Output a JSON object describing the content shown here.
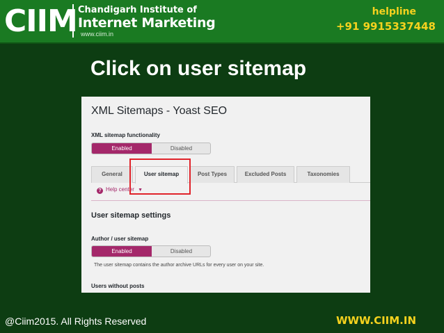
{
  "header": {
    "logo_text": "CIIM",
    "institute_line1": "Chandigarh Institute of",
    "institute_line2": "Internet Marketing",
    "url": "www.ciim.in",
    "helpline_label": "helpline",
    "helpline_number": "+91 9915337448"
  },
  "slide": {
    "title": "Click on user sitemap"
  },
  "screenshot": {
    "page_title": "XML Sitemaps - Yoast SEO",
    "functionality_label": "XML sitemap functionality",
    "functionality_toggle": {
      "on_label": "Enabled",
      "off_label": "Disabled",
      "selected": "Enabled"
    },
    "tabs": [
      {
        "label": "General",
        "active": false
      },
      {
        "label": "User sitemap",
        "active": true
      },
      {
        "label": "Post Types",
        "active": false
      },
      {
        "label": "Excluded Posts",
        "active": false
      },
      {
        "label": "Taxonomies",
        "active": false
      }
    ],
    "help_center_label": "Help center",
    "help_icon_glyph": "?",
    "section_title": "User sitemap settings",
    "author_label": "Author / user sitemap",
    "author_toggle": {
      "on_label": "Enabled",
      "off_label": "Disabled",
      "selected": "Enabled"
    },
    "author_description": "The user sitemap contains the author archive URLs for every user on your site.",
    "users_without_posts_label": "Users without posts"
  },
  "colors": {
    "background": "#0d3d12",
    "header": "#1a7a22",
    "accent_yellow": "#f6d21e",
    "toggle_on": "#a4286a",
    "highlight": "#e0232a"
  },
  "footer": {
    "copyright": "@Ciim2015. All Rights Reserved",
    "website": "WWW.CIIM.IN"
  }
}
